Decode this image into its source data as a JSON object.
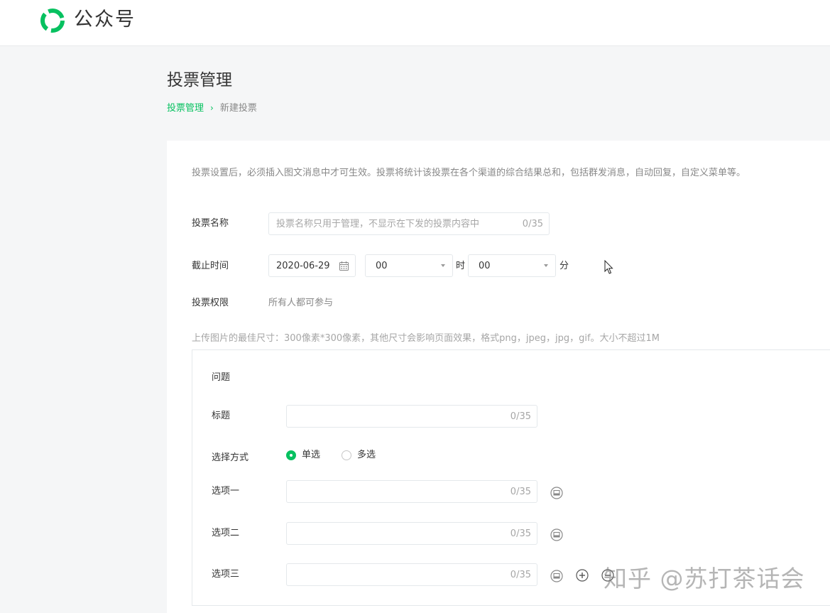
{
  "header": {
    "logo_text": "公众号",
    "brand_color": "#07c160"
  },
  "page": {
    "title": "投票管理",
    "breadcrumb": {
      "parent": "投票管理",
      "separator": "›",
      "current": "新建投票"
    }
  },
  "form": {
    "notice": "投票设置后，必须插入图文消息中才可生效。投票将统计该投票在各个渠道的综合结果总和，包括群发消息，自动回复，自定义菜单等。",
    "name": {
      "label": "投票名称",
      "placeholder": "投票名称只用于管理，不显示在下发的投票内容中",
      "counter": "0/35"
    },
    "deadline": {
      "label": "截止时间",
      "date": "2020-06-29",
      "hour": "00",
      "hour_unit": "时",
      "minute": "00",
      "minute_unit": "分"
    },
    "permission": {
      "label": "投票权限",
      "value": "所有人都可参与"
    },
    "upload_tip": "上传图片的最佳尺寸：300像素*300像素，其他尺寸会影响页面效果，格式png，jpeg，jpg，gif。大小不超过1M"
  },
  "question": {
    "heading": "问题",
    "title_label": "标题",
    "title_counter": "0/35",
    "mode_label": "选择方式",
    "mode_single": "单选",
    "mode_multi": "多选",
    "selected_mode": "单选",
    "options": [
      {
        "label": "选项一",
        "counter": "0/35"
      },
      {
        "label": "选项二",
        "counter": "0/35"
      },
      {
        "label": "选项三",
        "counter": "0/35"
      }
    ]
  },
  "watermark": "知乎 @苏打茶话会"
}
